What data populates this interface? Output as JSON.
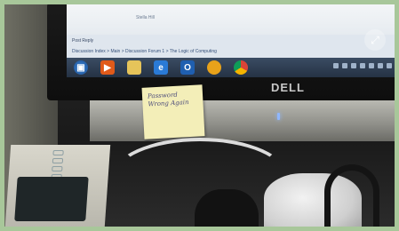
{
  "screen": {
    "post_reply": "Post Reply",
    "breadcrumb": "Discussion Index  >  Main  >  Discussion Forum 1  >  The Logic of Computing",
    "signature": "Stella  Hill"
  },
  "taskbar": {
    "icons": [
      "windows-start-icon",
      "media-player-icon",
      "folder-icon",
      "internet-explorer-icon",
      "outlook-icon",
      "unknown-app-icon",
      "chrome-icon"
    ]
  },
  "monitor": {
    "brand": "DELL"
  },
  "sticky_note": {
    "text": "Password\nWrong Again"
  },
  "colors": {
    "frame": "#a8c79a",
    "note": "#f3eeb8",
    "taskbar": "#2f3d52"
  }
}
